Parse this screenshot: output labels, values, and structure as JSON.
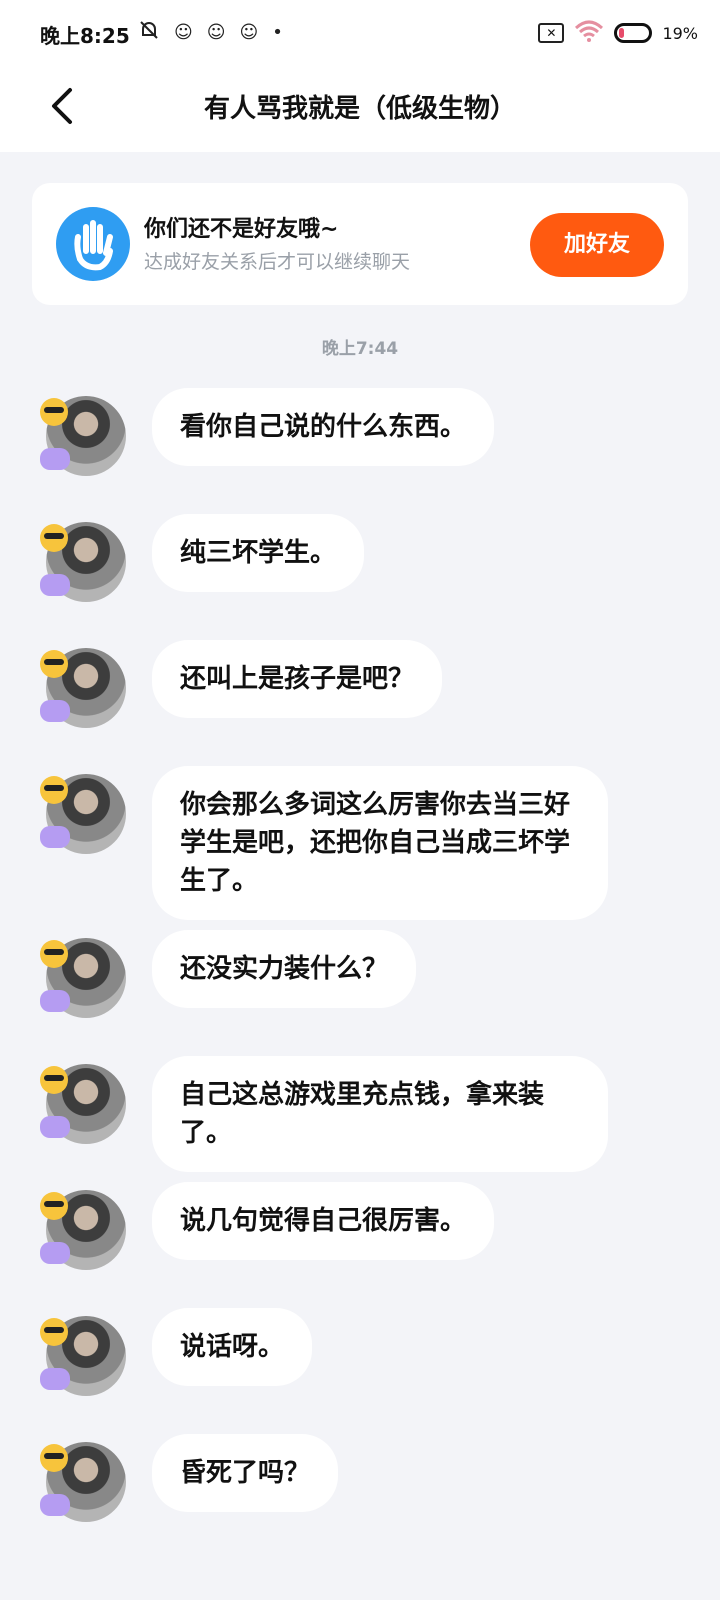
{
  "status_bar": {
    "time": "晚上8:25",
    "battery_text": "19",
    "battery_level": 0.19,
    "icons": [
      "mute-bell-icon",
      "app-notification-icon",
      "app-notification-icon",
      "app-notification-icon",
      "dot-icon",
      "sim-x-icon",
      "wifi-icon",
      "battery-icon"
    ]
  },
  "nav": {
    "title": "有人骂我就是（低级生物）",
    "back_icon": "chevron-left-icon"
  },
  "banner": {
    "title": "你们还不是好友哦~",
    "subtitle": "达成好友关系后才可以继续聊天",
    "button_label": "加好友",
    "button_color": "#ff5a10",
    "icon": "wave-hand-icon"
  },
  "timestamp": "晚上7:44",
  "messages": [
    {
      "text": "看你自己说的什么东西。"
    },
    {
      "text": "纯三坏学生。"
    },
    {
      "text": "还叫上是孩子是吧？"
    },
    {
      "text": "你会那么多词这么厉害你去当三好学生是吧，还把你自己当成三坏学生了。"
    },
    {
      "text": "还没实力装什么？"
    },
    {
      "text": "自己这总游戏里充点钱，拿来装了。"
    },
    {
      "text": "说几句觉得自己很厉害。"
    },
    {
      "text": "说话呀。"
    },
    {
      "text": "昏死了吗？"
    }
  ]
}
